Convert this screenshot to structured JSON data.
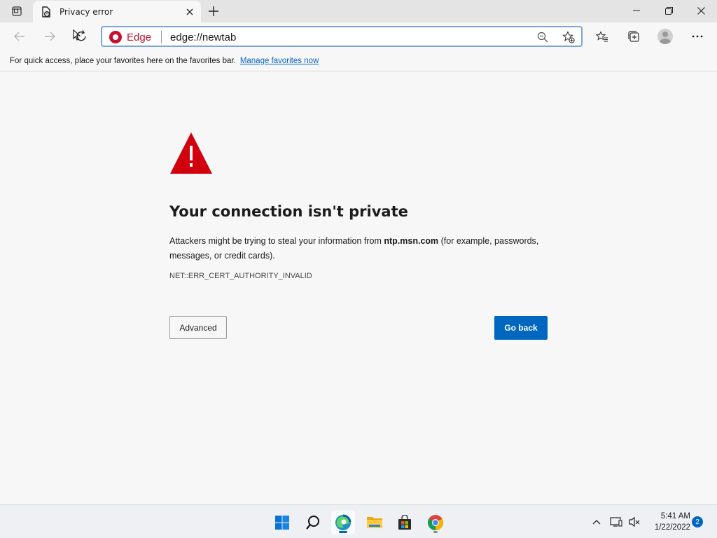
{
  "tab": {
    "title": "Privacy error"
  },
  "window": {
    "minimize": "minimize",
    "restore": "restore",
    "close": "close"
  },
  "omnibox": {
    "site_chip": "Edge",
    "url": "edge://newtab"
  },
  "favorites_bar": {
    "message": "For quick access, place your favorites here on the favorites bar.",
    "link": "Manage favorites now"
  },
  "error_page": {
    "heading": "Your connection isn't private",
    "desc_before": "Attackers might be trying to steal your information from ",
    "desc_host": "ntp.msn.com",
    "desc_after": " (for example, passwords, messages, or credit cards).",
    "error_code": "NET::ERR_CERT_AUTHORITY_INVALID",
    "advanced_label": "Advanced",
    "go_back_label": "Go back"
  },
  "taskbar": {
    "apps": [
      "start-icon",
      "search-icon",
      "edge-icon",
      "file-explorer-icon",
      "store-icon",
      "chrome-icon"
    ],
    "time": "5:41 AM",
    "date": "1/22/2022",
    "notification_count": "2"
  },
  "colors": {
    "accent": "#0067c0",
    "warning_red": "#d1000f",
    "edge_red": "#c8102e"
  }
}
